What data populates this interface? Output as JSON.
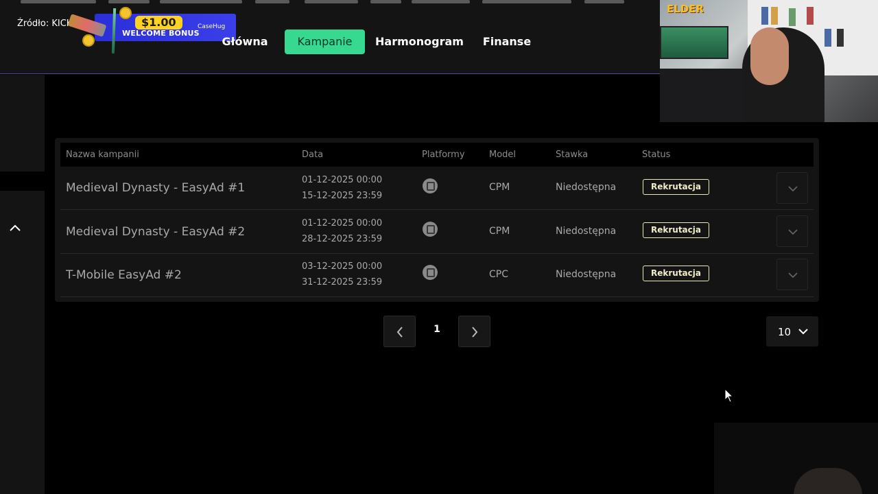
{
  "overlay": {
    "source_label": "Źródło: KICK",
    "promo_amount": "$1.00",
    "promo_text": "WELCOME BONUS",
    "promo_brand": "CaseHug",
    "streamer_logo": "ELDER"
  },
  "nav": {
    "items": [
      {
        "label": "Główna"
      },
      {
        "label": "Kampanie"
      },
      {
        "label": "Harmonogram"
      },
      {
        "label": "Finanse"
      }
    ],
    "active": "Kampanie"
  },
  "table": {
    "headers": {
      "name": "Nazwa kampanii",
      "date": "Data",
      "platform": "Platformy",
      "model": "Model",
      "rate": "Stawka",
      "status": "Status"
    },
    "rows": [
      {
        "name": "Medieval Dynasty - EasyAd #1",
        "start": "01-12-2025 00:00",
        "end": "15-12-2025 23:59",
        "platform_icon": "twitch-icon",
        "model": "CPM",
        "rate": "Niedostępna",
        "status": "Rekrutacja"
      },
      {
        "name": "Medieval Dynasty - EasyAd #2",
        "start": "01-12-2025 00:00",
        "end": "28-12-2025 23:59",
        "platform_icon": "twitch-icon",
        "model": "CPM",
        "rate": "Niedostępna",
        "status": "Rekrutacja"
      },
      {
        "name": "T-Mobile EasyAd #2",
        "start": "03-12-2025 00:00",
        "end": "31-12-2025 23:59",
        "platform_icon": "twitch-icon",
        "model": "CPC",
        "rate": "Niedostępna",
        "status": "Rekrutacja"
      }
    ]
  },
  "pagination": {
    "current_page": "1",
    "per_page": "10"
  },
  "colors": {
    "accent": "#37d890",
    "status_border": "#f0e9b9",
    "header_divider": "#5b3fa6"
  }
}
